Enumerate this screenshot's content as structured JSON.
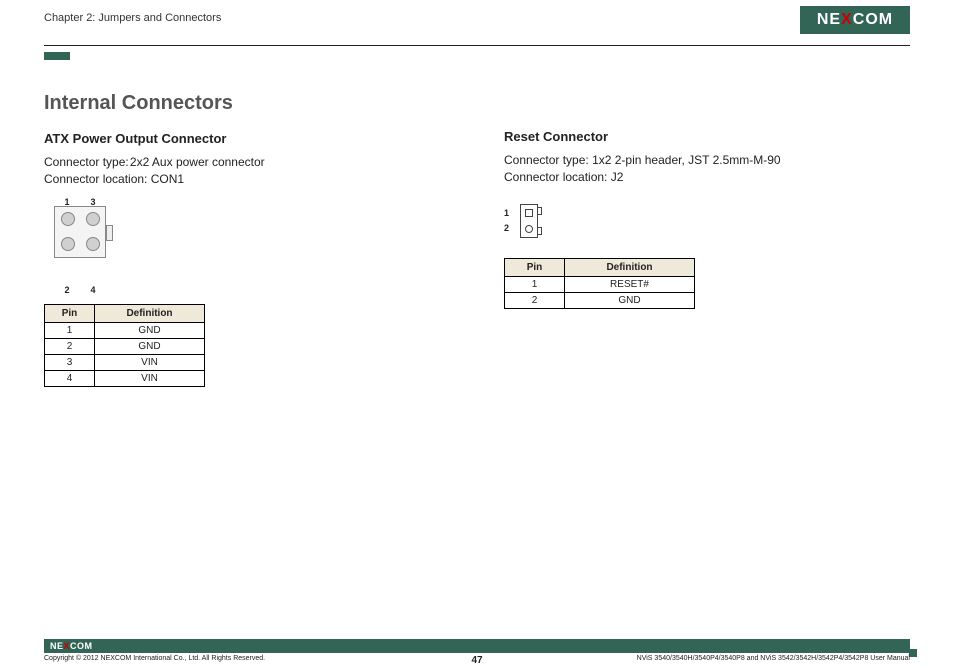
{
  "page": {
    "chapter": "Chapter 2: Jumpers and Connectors",
    "brand": "NEXCOM",
    "brand_pre": "NE",
    "brand_x": "X",
    "brand_post": "COM",
    "copyright": "Copyright © 2012 NEXCOM International Co., Ltd. All Rights Reserved.",
    "manual_ref": "NViS 3540/3540H/3540P4/3540P8 and NViS 3542/3542H/3542P4/3542P8 User Manual",
    "page_number": "47"
  },
  "section_title": "Internal Connectors",
  "atx": {
    "title": "ATX Power Output Connector",
    "type_label": "Connector type:",
    "type_value": "2x2 Aux power connector",
    "loc_label": "Connector location: ",
    "loc_value": "CON1",
    "pin_labels_top": {
      "left": "1",
      "right": "3"
    },
    "pin_labels_bottom": {
      "left": "2",
      "right": "4"
    },
    "table": {
      "headers": {
        "pin": "Pin",
        "def": "Definition"
      },
      "rows": [
        {
          "pin": "1",
          "def": "GND"
        },
        {
          "pin": "2",
          "def": "GND"
        },
        {
          "pin": "3",
          "def": "VIN"
        },
        {
          "pin": "4",
          "def": "VIN"
        }
      ]
    }
  },
  "reset": {
    "title": "Reset Connector",
    "type_label": "Connector type: ",
    "type_value": "1x2 2-pin header, JST 2.5mm-M-90",
    "loc_label": "Connector location: ",
    "loc_value": "J2",
    "pin_labels": {
      "one": "1",
      "two": "2"
    },
    "table": {
      "headers": {
        "pin": "Pin",
        "def": "Definition"
      },
      "rows": [
        {
          "pin": "1",
          "def": "RESET#"
        },
        {
          "pin": "2",
          "def": "GND"
        }
      ]
    }
  }
}
